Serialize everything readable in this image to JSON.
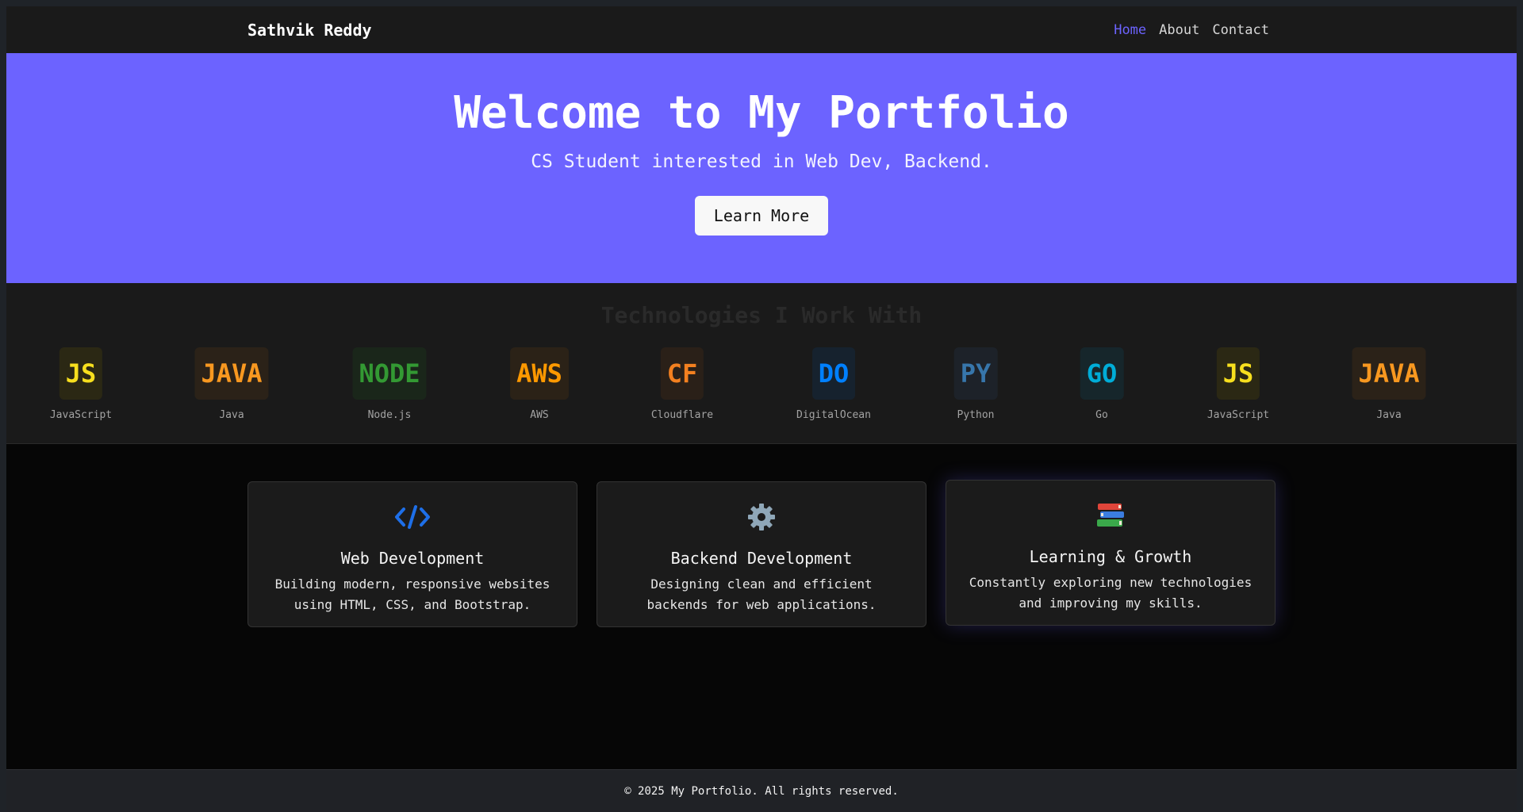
{
  "navbar": {
    "brand": "Sathvik Reddy",
    "links": [
      {
        "label": "Home",
        "active": true
      },
      {
        "label": "About",
        "active": false
      },
      {
        "label": "Contact",
        "active": false
      }
    ]
  },
  "hero": {
    "title": "Welcome to My Portfolio",
    "subtitle": "CS Student interested in Web Dev, Backend.",
    "button_label": "Learn More",
    "background": "#6c63ff"
  },
  "tech": {
    "heading": "Technologies I Work With",
    "items": [
      {
        "badge": "JS",
        "label": "JavaScript",
        "color": "#f7df1e",
        "bg": "#2b2814"
      },
      {
        "badge": "JAVA",
        "label": "Java",
        "color": "#f89820",
        "bg": "#2b2218"
      },
      {
        "badge": "NODE",
        "label": "Node.js",
        "color": "#339933",
        "bg": "#1a261a"
      },
      {
        "badge": "AWS",
        "label": "AWS",
        "color": "#ff9900",
        "bg": "#2b2217"
      },
      {
        "badge": "CF",
        "label": "Cloudflare",
        "color": "#f38020",
        "bg": "#2a2018"
      },
      {
        "badge": "DO",
        "label": "DigitalOcean",
        "color": "#0080ff",
        "bg": "#16222e"
      },
      {
        "badge": "PY",
        "label": "Python",
        "color": "#3776ab",
        "bg": "#1d2229"
      },
      {
        "badge": "GO",
        "label": "Go",
        "color": "#00add8",
        "bg": "#16262b"
      },
      {
        "badge": "JS",
        "label": "JavaScript",
        "color": "#f7df1e",
        "bg": "#2b2814"
      },
      {
        "badge": "JAVA",
        "label": "Java",
        "color": "#f89820",
        "bg": "#2b2218"
      }
    ]
  },
  "cards": [
    {
      "icon": "code-icon",
      "glyph": "</>",
      "title": "Web Development",
      "text": "Building modern, responsive websites using HTML, CSS, and Bootstrap."
    },
    {
      "icon": "gear-icon",
      "glyph": "⚙️",
      "title": "Backend Development",
      "text": "Designing clean and efficient backends for web applications."
    },
    {
      "icon": "books-icon",
      "glyph": "📚",
      "title": "Learning & Growth",
      "text": "Constantly exploring new technologies and improving my skills."
    }
  ],
  "footer": {
    "text": "© 2025 My Portfolio. All rights reserved."
  }
}
